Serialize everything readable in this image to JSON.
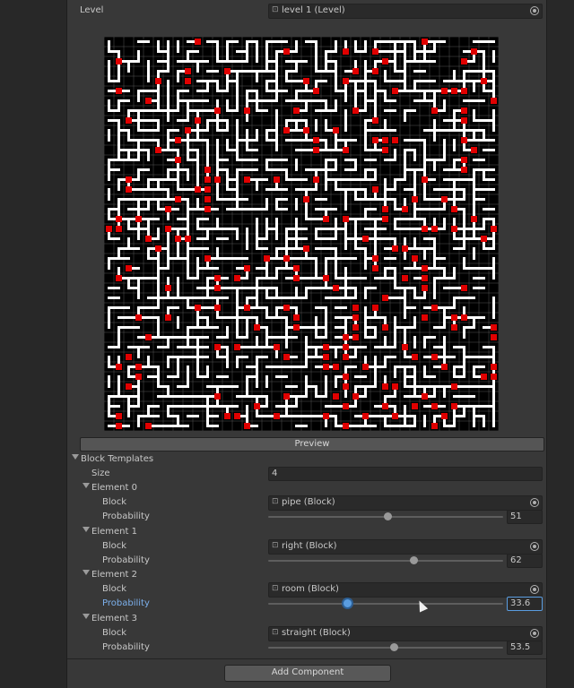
{
  "level": {
    "label": "Level",
    "value": "level 1 (Level)",
    "icon": "asset-icon"
  },
  "preview": {
    "button_label": "Preview",
    "colors": {
      "wall": "#000000",
      "path": "#ffffff",
      "room": "#e00000",
      "grid": "#555555"
    }
  },
  "block_templates": {
    "label": "Block Templates",
    "size_label": "Size",
    "size_value": "4",
    "block_label": "Block",
    "probability_label": "Probability",
    "elements": [
      {
        "title": "Element 0",
        "block": "pipe (Block)",
        "probability": "51",
        "slider_fraction": 0.51
      },
      {
        "title": "Element 1",
        "block": "right (Block)",
        "probability": "62",
        "slider_fraction": 0.62
      },
      {
        "title": "Element 2",
        "block": "room (Block)",
        "probability": "33.6",
        "slider_fraction": 0.336
      },
      {
        "title": "Element 3",
        "block": "straight (Block)",
        "probability": "53.5",
        "slider_fraction": 0.535
      }
    ]
  },
  "add_component": {
    "label": "Add Component"
  }
}
